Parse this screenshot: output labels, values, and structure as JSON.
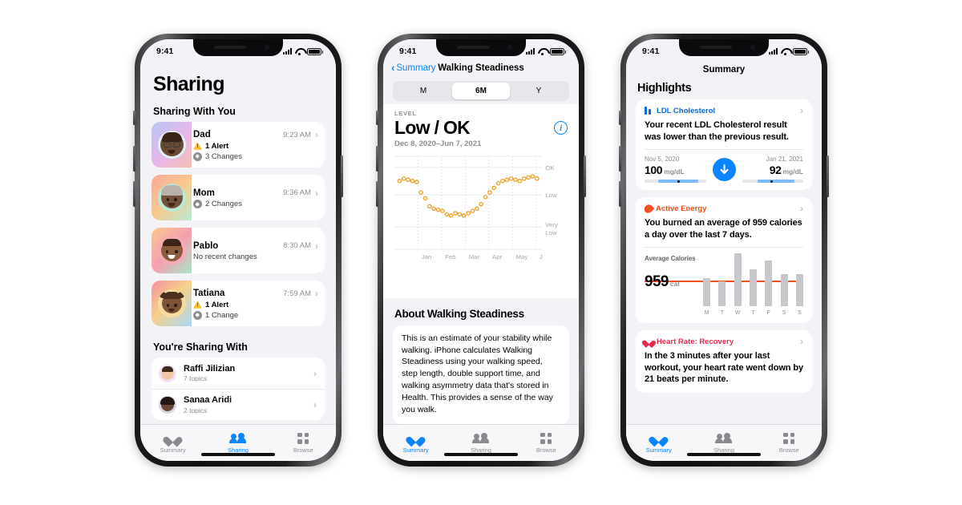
{
  "statusbar": {
    "time": "9:41"
  },
  "phone1": {
    "title": "Sharing",
    "section_sharing_with_you": "Sharing With You",
    "section_youre_sharing": "You're Sharing With",
    "shared_with_you": [
      {
        "name": "Dad",
        "time": "9:23 AM",
        "alert": "1 Alert",
        "changes": "3 Changes"
      },
      {
        "name": "Mom",
        "time": "9:36 AM",
        "alert": "",
        "changes": "2 Changes"
      },
      {
        "name": "Pablo",
        "time": "8:30 AM",
        "alert": "",
        "changes": "No recent changes"
      },
      {
        "name": "Tatiana",
        "time": "7:59 AM",
        "alert": "1 Alert",
        "changes": "1 Change"
      }
    ],
    "sharing_with": [
      {
        "name": "Raffi Jilizian",
        "sub": "7 topics"
      },
      {
        "name": "Sanaa Aridi",
        "sub": "2 topics"
      }
    ],
    "tabs": [
      {
        "label": "Summary",
        "icon": "heart-icon",
        "active": false
      },
      {
        "label": "Sharing",
        "icon": "people-icon",
        "active": true
      },
      {
        "label": "Browse",
        "icon": "grid-icon",
        "active": false
      }
    ]
  },
  "phone2": {
    "back_label": "Summary",
    "nav_title": "Walking Steadiness",
    "segments": [
      {
        "label": "M",
        "selected": false
      },
      {
        "label": "6M",
        "selected": true
      },
      {
        "label": "Y",
        "selected": false
      }
    ],
    "level_label": "LEVEL",
    "level_value": "Low / OK",
    "date_range": "Dec 8, 2020–Jun 7, 2021",
    "info_icon": "info-icon",
    "about_heading": "About Walking Steadiness",
    "about_text": "This is an estimate of your stability while walking. iPhone calculates Walking Steadiness using your walking speed, step length, double support time, and walking asymmetry data that's stored in Health. This provides a sense of the way you walk.",
    "tabs": [
      {
        "label": "Summary",
        "icon": "heart-icon",
        "active": true
      },
      {
        "label": "Sharing",
        "icon": "people-icon",
        "active": false
      },
      {
        "label": "Browse",
        "icon": "grid-icon",
        "active": false
      }
    ]
  },
  "phone3": {
    "nav_title": "Summary",
    "highlights_heading": "Highlights",
    "cards": [
      {
        "title": "LDL Cholesterol",
        "icon": "ldl-bars-icon",
        "color": "#0a6cd8",
        "text": "Your recent LDL Cholesterol result was lower than the previous result.",
        "left_date": "Nov 5, 2020",
        "left_value": "100",
        "left_unit": "mg/dL",
        "right_date": "Jan 21, 2021",
        "right_value": "92",
        "right_unit": "mg/dL",
        "trend_icon": "arrow-down-icon"
      },
      {
        "title": "Active Energy",
        "icon": "flame-icon",
        "color": "#e8501a",
        "text": "You burned an average of 959 calories a day over the last 7 days.",
        "chart_label": "Average Calories",
        "value": "959",
        "unit": "cal"
      },
      {
        "title": "Heart Rate: Recovery",
        "icon": "heart-icon",
        "color": "#eb2b49",
        "text": "In the 3 minutes after your last workout, your heart rate went down by 21 beats per minute."
      }
    ],
    "tabs": [
      {
        "label": "Summary",
        "icon": "heart-icon",
        "active": true
      },
      {
        "label": "Sharing",
        "icon": "people-icon",
        "active": false
      },
      {
        "label": "Browse",
        "icon": "grid-icon",
        "active": false
      }
    ]
  },
  "chart_data": [
    {
      "type": "scatter",
      "title": "Walking Steadiness",
      "subtitle": "Low / OK",
      "xlabel": "",
      "ylabel": "",
      "x_tick_labels": [
        "Jan",
        "Feb",
        "Mar",
        "Apr",
        "May",
        "J"
      ],
      "y_tick_labels": [
        "OK",
        "Low",
        "Very Low"
      ],
      "ylim": [
        0,
        100
      ],
      "grid": true,
      "legend": "none",
      "point_color": "#f0a02a",
      "date_range": "Dec 8, 2020–Jun 7, 2021",
      "values": [
        72,
        74,
        73,
        72,
        71,
        62,
        57,
        50,
        48,
        47,
        46,
        43,
        42,
        44,
        43,
        42,
        44,
        46,
        48,
        52,
        58,
        62,
        66,
        70,
        72,
        73,
        74,
        73,
        72,
        74,
        75,
        76,
        74
      ]
    },
    {
      "type": "bar",
      "title": "Average Calories",
      "categories": [
        "M",
        "T",
        "W",
        "T",
        "F",
        "S",
        "S"
      ],
      "values": [
        760,
        680,
        1430,
        1000,
        1240,
        880,
        870
      ],
      "average_line": 959,
      "ylabel": "cal",
      "xlabel": "",
      "bar_color": "#c7c7cc",
      "average_color": "#f4511e",
      "legend": "none",
      "grid": false
    },
    {
      "type": "bar",
      "title": "LDL Cholesterol comparison",
      "categories": [
        "Nov 5, 2020",
        "Jan 21, 2021"
      ],
      "values": [
        100,
        92
      ],
      "ylabel": "mg/dL",
      "xlabel": "",
      "legend": "none",
      "grid": false
    }
  ]
}
